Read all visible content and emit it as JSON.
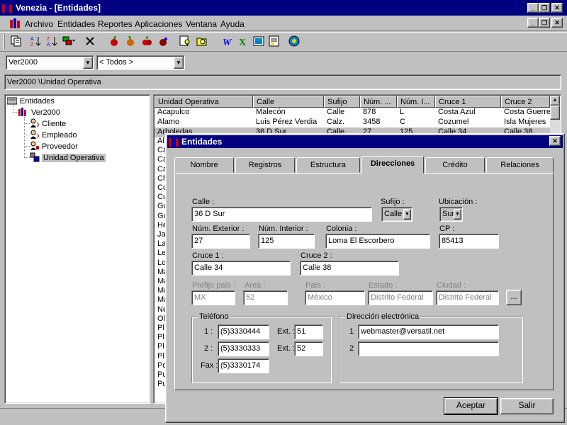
{
  "app": {
    "title": "Venezia - [Entidades]"
  },
  "menu": {
    "items": [
      "Archivo",
      "Entidades",
      "Reportes",
      "Aplicaciones",
      "Ventana",
      "Ayuda"
    ]
  },
  "filters": {
    "version": "Ver2000",
    "scope": "< Todos >"
  },
  "path": {
    "text": "Ver2000 \\Unidad Operativa"
  },
  "tree": {
    "root": "Entidades",
    "version": "Ver2000",
    "items": [
      "Cliente",
      "Empleado",
      "Proveedor",
      "Unidad Operativa"
    ]
  },
  "grid": {
    "columns": [
      "Unidad Operativa",
      "Calle",
      "Sufijo",
      "Núm. ...",
      "Núm. I...",
      "Cruce 1",
      "Cruce 2"
    ],
    "rows": [
      [
        "Acapulco",
        "Malecón",
        "Calle",
        "878",
        "L",
        "Costa Azul",
        "Costa Guerrero"
      ],
      [
        "Alamo",
        "Luis Pérez Verdia",
        "Calz.",
        "3458",
        "C",
        "Cozumel",
        "Isla Mujeres"
      ],
      [
        "Arboledas",
        "36 D Sur",
        "Calle",
        "27",
        "125",
        "Calle 34",
        "Calle 38"
      ]
    ],
    "partial_first_letters": [
      "Al",
      "Ca",
      "Ca",
      "Ca",
      "Ch",
      "Co",
      "Cu",
      "Gu",
      "Gu",
      "He",
      "Ja",
      "La",
      "Le",
      "Lo",
      "Ma",
      "Ma",
      "Ma",
      "Ma",
      "Ne",
      "Ol",
      "Pl",
      "Pl",
      "Pl",
      "Pl",
      "Po",
      "Pu",
      "Pu"
    ]
  },
  "dialog": {
    "title": "Entidades",
    "tabs": [
      "Nombre",
      "Registros",
      "Estructura",
      "Direcciones",
      "Crédito",
      "Relaciones"
    ],
    "labels": {
      "calle": "Calle :",
      "sufijo": "Sufijo :",
      "ubicacion": "Ubicación :",
      "num_ext": "Núm. Exterior :",
      "num_int": "Núm. Interior :",
      "colonia": "Colonia :",
      "cp": "CP :",
      "cruce1": "Cruce 1 :",
      "cruce2": "Cruce 2 :",
      "prefijo": "Prefijo país :",
      "area": "Area :",
      "pais": "País :",
      "estado": "Estado :",
      "ciudad": "Ciudad :",
      "telefono": "Teléfono",
      "t1": "1 :",
      "t2": "2 :",
      "fax": "Fax :",
      "ext": "Ext. :",
      "direccion": "Dirección electrónica",
      "d1": "1",
      "d2": "2"
    },
    "values": {
      "calle": "36 D Sur",
      "sufijo": "Calle",
      "ubicacion": "Sur",
      "num_ext": "27",
      "num_int": "125",
      "colonia": "Loma El Escorbero",
      "cp": "85413",
      "cruce1": "Calle 34",
      "cruce2": "Calle 38",
      "prefijo": "MX",
      "area": "52",
      "pais": "México",
      "estado": "Distrito Federal",
      "ciudad": "Distrito Federal",
      "tel1": "(5)3330444",
      "ext1": "51",
      "tel2": "(5)3330333",
      "ext2": "52",
      "fax": "(5)3330174",
      "email1": "webmaster@versatil.net",
      "email2": ""
    },
    "buttons": {
      "more": "...",
      "accept": "Aceptar",
      "exit": "Salir"
    }
  }
}
